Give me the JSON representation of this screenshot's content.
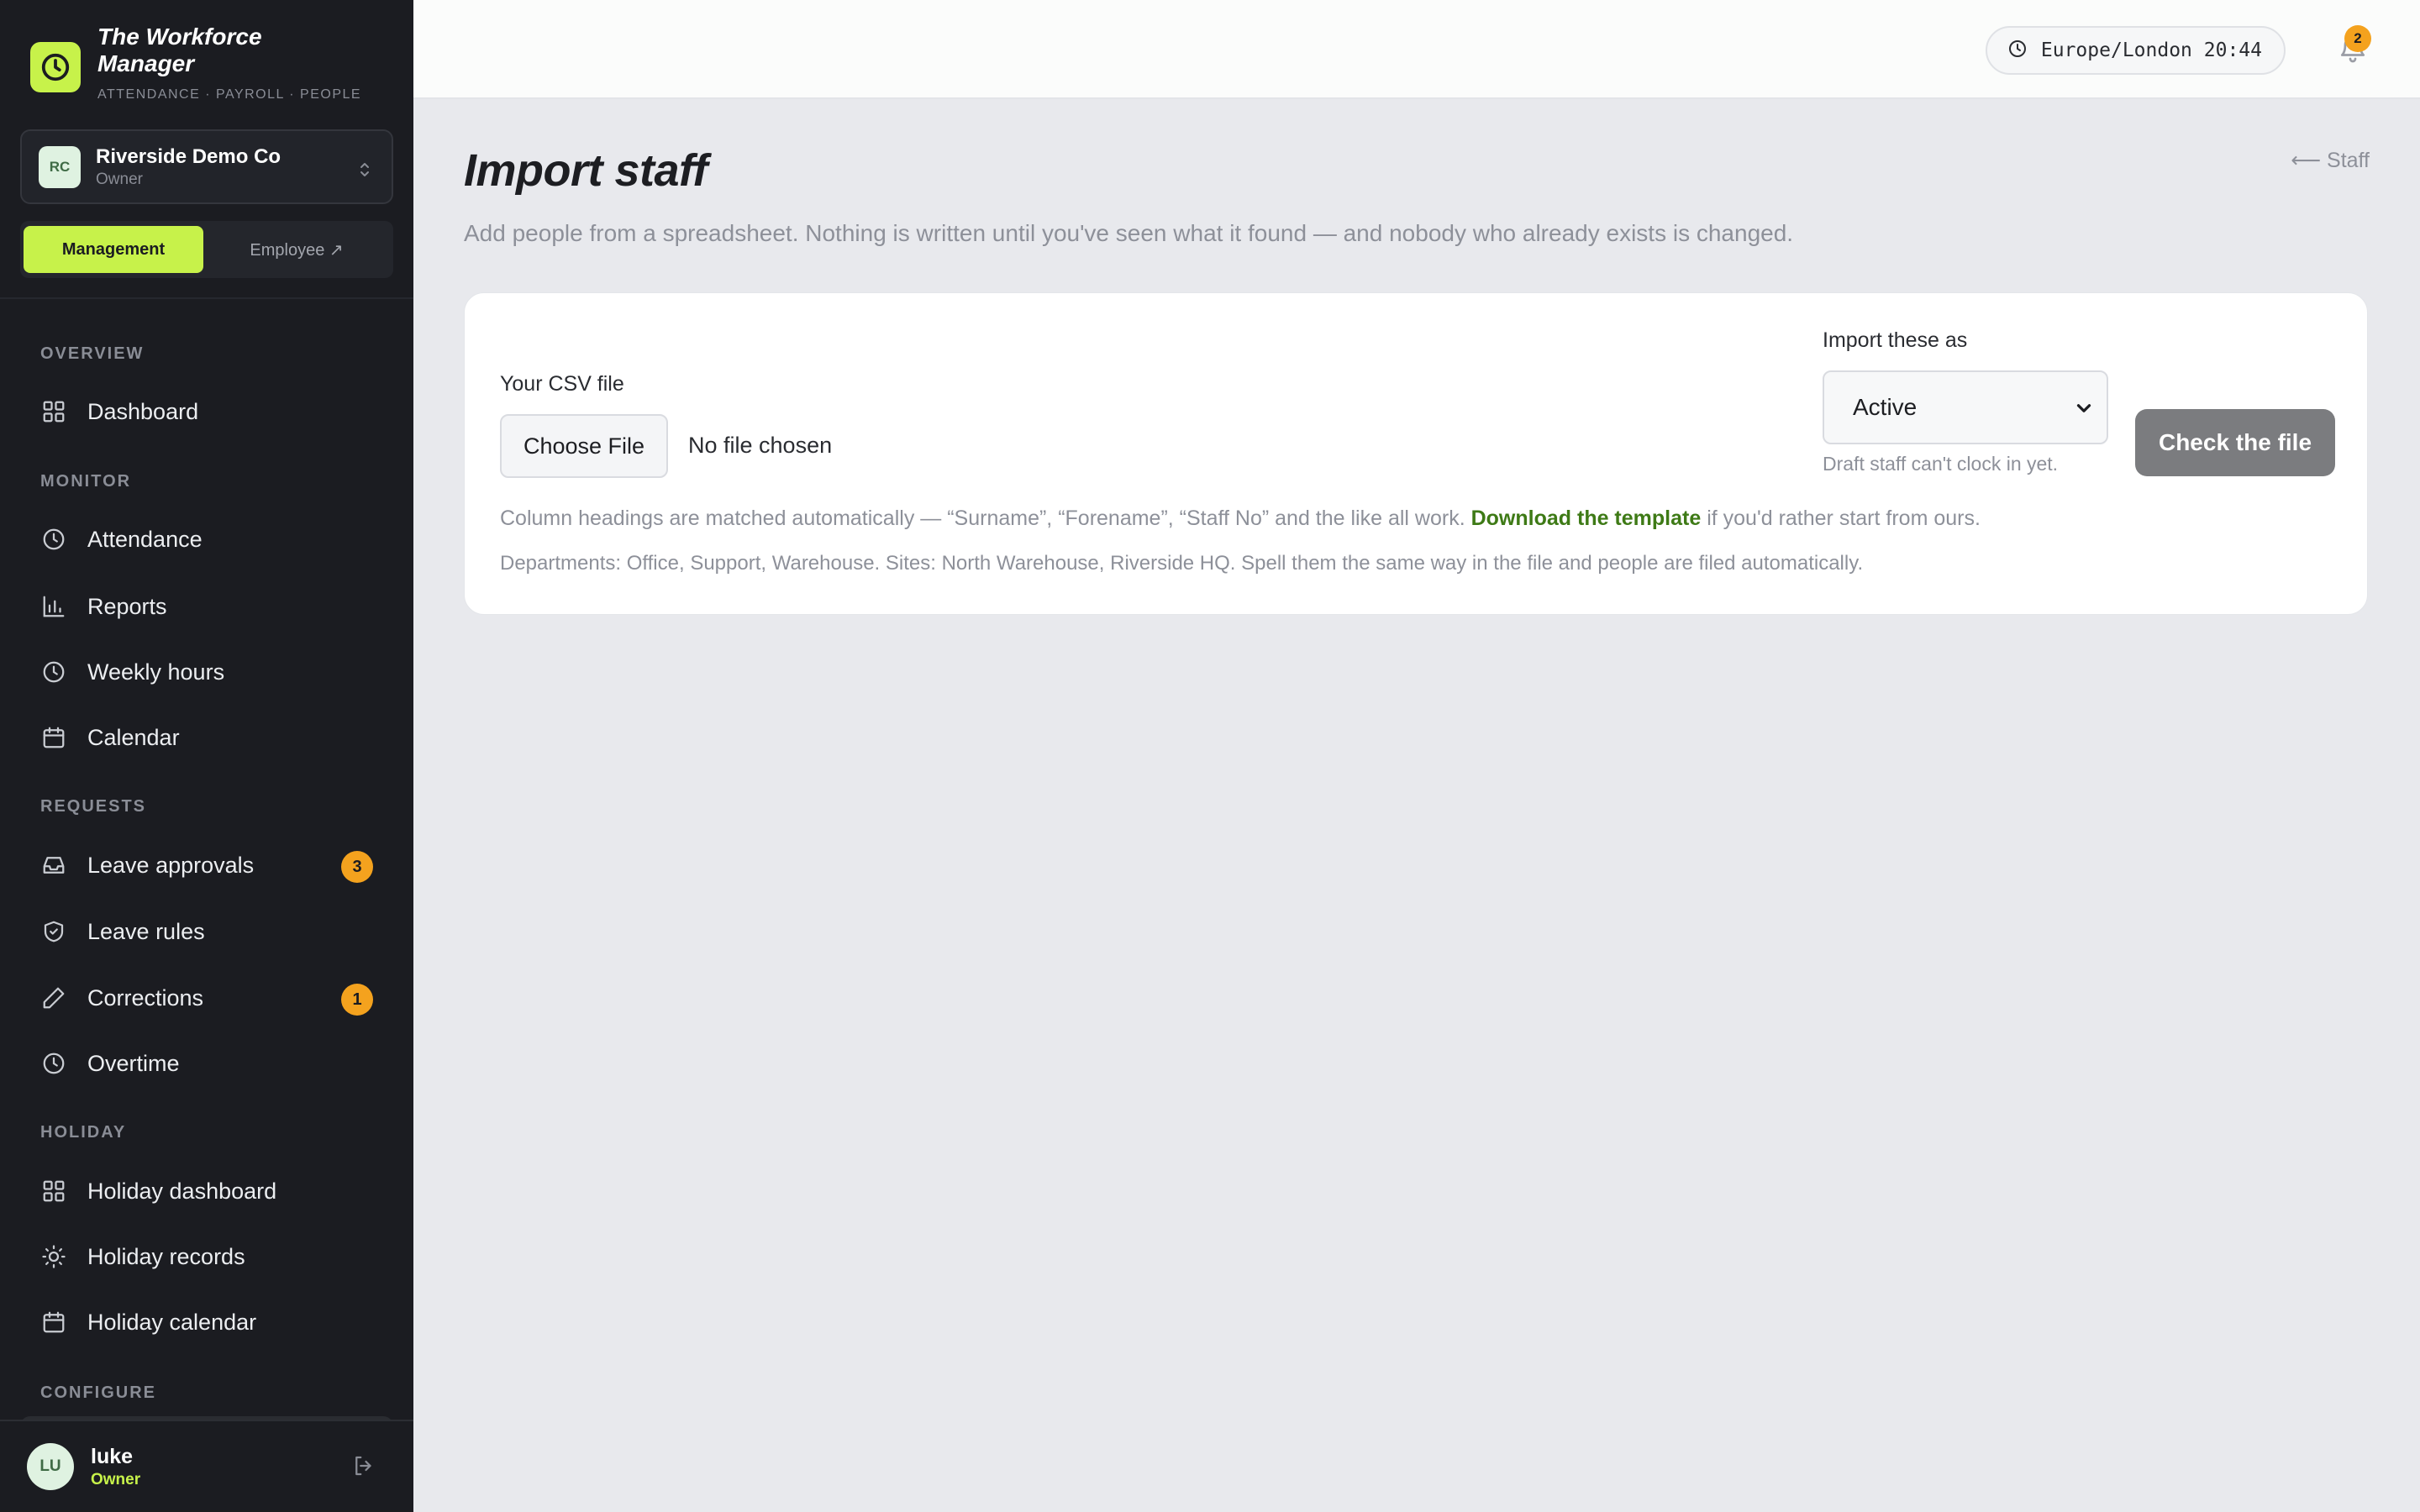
{
  "brand": {
    "title": "The Workforce Manager",
    "tagline": "ATTENDANCE · PAYROLL · PEOPLE"
  },
  "org": {
    "initials": "RC",
    "name": "Riverside Demo Co",
    "role": "Owner"
  },
  "mode": {
    "active": "Management",
    "inactive": "Employee ↗"
  },
  "nav": {
    "sections": {
      "overview": "OVERVIEW",
      "monitor": "MONITOR",
      "requests": "REQUESTS",
      "holiday": "HOLIDAY",
      "configure": "CONFIGURE"
    },
    "items": {
      "dashboard": "Dashboard",
      "attendance": "Attendance",
      "reports": "Reports",
      "weekly_hours": "Weekly hours",
      "calendar": "Calendar",
      "leave_approvals": "Leave approvals",
      "leave_approvals_badge": "3",
      "leave_rules": "Leave rules",
      "corrections": "Corrections",
      "corrections_badge": "1",
      "overtime": "Overtime",
      "holiday_dashboard": "Holiday dashboard",
      "holiday_records": "Holiday records",
      "holiday_calendar": "Holiday calendar"
    }
  },
  "user": {
    "initials": "LU",
    "name": "luke",
    "role": "Owner"
  },
  "topbar": {
    "timezone": "Europe/London 20:44",
    "notifications": "2"
  },
  "page": {
    "title": "Import staff",
    "back_link": "⟵ Staff",
    "subtitle": "Add people from a spreadsheet. Nothing is written until you've seen what it found — and nobody who already exists is changed."
  },
  "form": {
    "csv_label": "Your CSV file",
    "choose_file": "Choose File",
    "file_status": "No file chosen",
    "import_as_label": "Import these as",
    "import_as_value": "Active",
    "hint": "Draft staff can't clock in yet.",
    "submit": "Check the file",
    "info_prefix": "Column headings are matched automatically — “Surname”, “Forename”, “Staff No” and the like all work.",
    "info_link": "Download the template",
    "info_suffix": "if you'd rather start from ours.",
    "info_departments": "Departments: Office, Support, Warehouse. Sites: North Warehouse, Riverside HQ. Spell them the same way in the file and people are filed automatically."
  },
  "colors": {
    "accent": "#c7f24a",
    "sidebar_bg": "#1b1c21",
    "badge": "#f4a21e",
    "link": "#3e7a16",
    "button_disabled": "#7b7c7f"
  }
}
